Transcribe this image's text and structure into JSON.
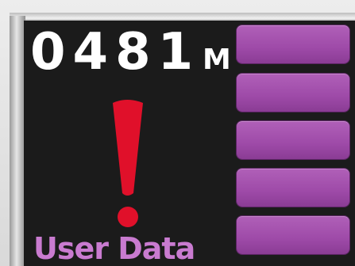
{
  "display": {
    "counter": "0481",
    "unit": "M",
    "label": "User Data",
    "alert_icon": "exclamation-icon"
  },
  "softkeys": [
    {
      "label": ""
    },
    {
      "label": ""
    },
    {
      "label": ""
    },
    {
      "label": ""
    },
    {
      "label": ""
    }
  ],
  "colors": {
    "screen": "#1b1b1b",
    "counter_text": "#ffffff",
    "alert": "#e0102a",
    "label_text": "#c97bd0",
    "softkey": "#a050ab"
  }
}
